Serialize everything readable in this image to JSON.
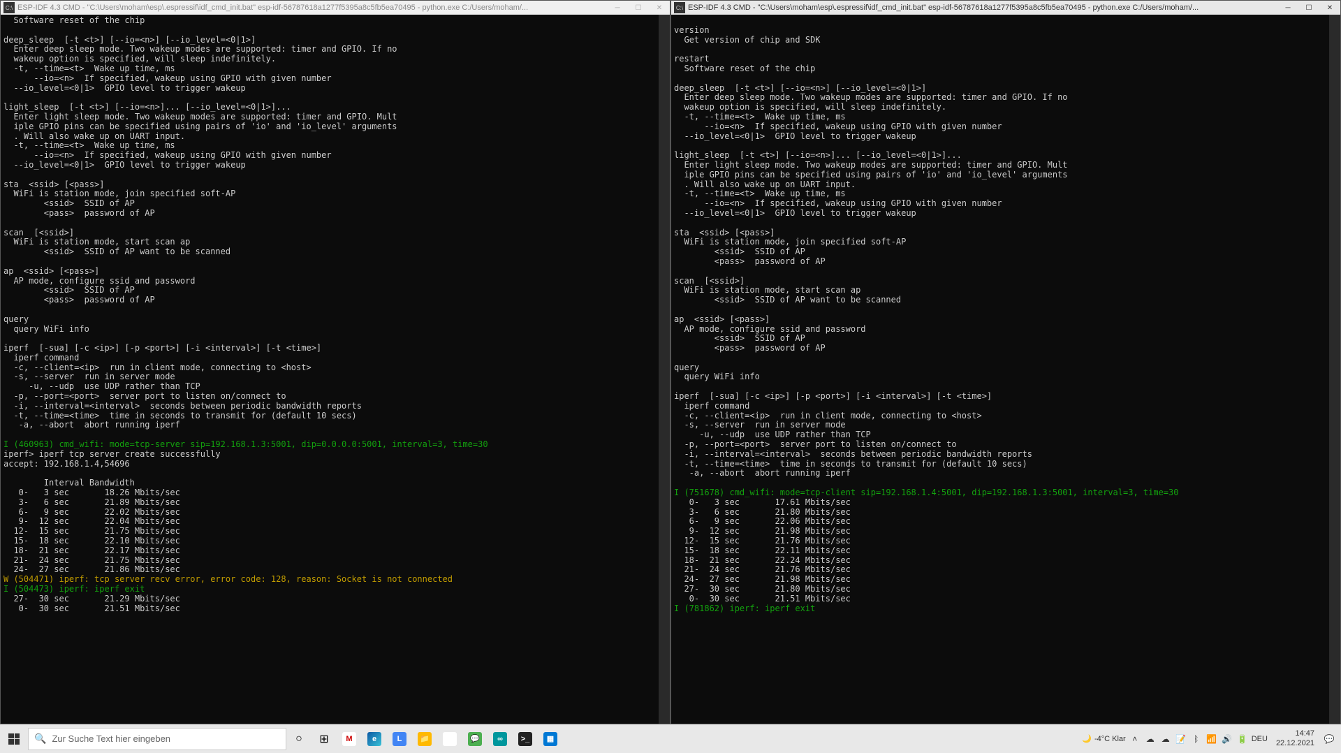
{
  "window_left": {
    "title": "ESP-IDF 4.3 CMD - \"C:\\Users\\moham\\esp\\.espressif\\idf_cmd_init.bat\"  esp-idf-56787618a1277f5395a8c5fb5ea70495 - python.exe  C:/Users/moham/...",
    "lines": [
      {
        "t": "  Software reset of the chip"
      },
      {
        "t": ""
      },
      {
        "t": "deep_sleep  [-t <t>] [--io=<n>] [--io_level=<0|1>]"
      },
      {
        "t": "  Enter deep sleep mode. Two wakeup modes are supported: timer and GPIO. If no"
      },
      {
        "t": "  wakeup option is specified, will sleep indefinitely."
      },
      {
        "t": "  -t, --time=<t>  Wake up time, ms"
      },
      {
        "t": "      --io=<n>  If specified, wakeup using GPIO with given number"
      },
      {
        "t": "  --io_level=<0|1>  GPIO level to trigger wakeup"
      },
      {
        "t": ""
      },
      {
        "t": "light_sleep  [-t <t>] [--io=<n>]... [--io_level=<0|1>]..."
      },
      {
        "t": "  Enter light sleep mode. Two wakeup modes are supported: timer and GPIO. Mult"
      },
      {
        "t": "  iple GPIO pins can be specified using pairs of 'io' and 'io_level' arguments"
      },
      {
        "t": "  . Will also wake up on UART input."
      },
      {
        "t": "  -t, --time=<t>  Wake up time, ms"
      },
      {
        "t": "      --io=<n>  If specified, wakeup using GPIO with given number"
      },
      {
        "t": "  --io_level=<0|1>  GPIO level to trigger wakeup"
      },
      {
        "t": ""
      },
      {
        "t": "sta  <ssid> [<pass>]"
      },
      {
        "t": "  WiFi is station mode, join specified soft-AP"
      },
      {
        "t": "        <ssid>  SSID of AP"
      },
      {
        "t": "        <pass>  password of AP"
      },
      {
        "t": ""
      },
      {
        "t": "scan  [<ssid>]"
      },
      {
        "t": "  WiFi is station mode, start scan ap"
      },
      {
        "t": "        <ssid>  SSID of AP want to be scanned"
      },
      {
        "t": ""
      },
      {
        "t": "ap  <ssid> [<pass>]"
      },
      {
        "t": "  AP mode, configure ssid and password"
      },
      {
        "t": "        <ssid>  SSID of AP"
      },
      {
        "t": "        <pass>  password of AP"
      },
      {
        "t": ""
      },
      {
        "t": "query"
      },
      {
        "t": "  query WiFi info"
      },
      {
        "t": ""
      },
      {
        "t": "iperf  [-sua] [-c <ip>] [-p <port>] [-i <interval>] [-t <time>]"
      },
      {
        "t": "  iperf command"
      },
      {
        "t": "  -c, --client=<ip>  run in client mode, connecting to <host>"
      },
      {
        "t": "  -s, --server  run in server mode"
      },
      {
        "t": "     -u, --udp  use UDP rather than TCP"
      },
      {
        "t": "  -p, --port=<port>  server port to listen on/connect to"
      },
      {
        "t": "  -i, --interval=<interval>  seconds between periodic bandwidth reports"
      },
      {
        "t": "  -t, --time=<time>  time in seconds to transmit for (default 10 secs)"
      },
      {
        "t": "   -a, --abort  abort running iperf"
      },
      {
        "t": ""
      },
      {
        "t": "I (460963) cmd_wifi: mode=tcp-server sip=192.168.1.3:5001, dip=0.0.0.0:5001, interval=3, time=30",
        "c": "g"
      },
      {
        "t": "iperf> iperf tcp server create successfully"
      },
      {
        "t": "accept: 192.168.1.4,54696"
      },
      {
        "t": ""
      },
      {
        "t": "        Interval Bandwidth"
      },
      {
        "t": "   0-   3 sec       18.26 Mbits/sec"
      },
      {
        "t": "   3-   6 sec       21.89 Mbits/sec"
      },
      {
        "t": "   6-   9 sec       22.02 Mbits/sec"
      },
      {
        "t": "   9-  12 sec       22.04 Mbits/sec"
      },
      {
        "t": "  12-  15 sec       21.75 Mbits/sec"
      },
      {
        "t": "  15-  18 sec       22.10 Mbits/sec"
      },
      {
        "t": "  18-  21 sec       22.17 Mbits/sec"
      },
      {
        "t": "  21-  24 sec       21.75 Mbits/sec"
      },
      {
        "t": "  24-  27 sec       21.86 Mbits/sec"
      },
      {
        "t": "W (504471) iperf: tcp server recv error, error code: 128, reason: Socket is not connected",
        "c": "y"
      },
      {
        "t": "I (504473) iperf: iperf exit",
        "c": "g"
      },
      {
        "t": "  27-  30 sec       21.29 Mbits/sec"
      },
      {
        "t": "   0-  30 sec       21.51 Mbits/sec"
      }
    ]
  },
  "window_right": {
    "title": "ESP-IDF 4.3 CMD - \"C:\\Users\\moham\\esp\\.espressif\\idf_cmd_init.bat\"  esp-idf-56787618a1277f5395a8c5fb5ea70495 - python.exe  C:/Users/moham/...",
    "lines": [
      {
        "t": ""
      },
      {
        "t": "version"
      },
      {
        "t": "  Get version of chip and SDK"
      },
      {
        "t": ""
      },
      {
        "t": "restart"
      },
      {
        "t": "  Software reset of the chip"
      },
      {
        "t": ""
      },
      {
        "t": "deep_sleep  [-t <t>] [--io=<n>] [--io_level=<0|1>]"
      },
      {
        "t": "  Enter deep sleep mode. Two wakeup modes are supported: timer and GPIO. If no"
      },
      {
        "t": "  wakeup option is specified, will sleep indefinitely."
      },
      {
        "t": "  -t, --time=<t>  Wake up time, ms"
      },
      {
        "t": "      --io=<n>  If specified, wakeup using GPIO with given number"
      },
      {
        "t": "  --io_level=<0|1>  GPIO level to trigger wakeup"
      },
      {
        "t": ""
      },
      {
        "t": "light_sleep  [-t <t>] [--io=<n>]... [--io_level=<0|1>]..."
      },
      {
        "t": "  Enter light sleep mode. Two wakeup modes are supported: timer and GPIO. Mult"
      },
      {
        "t": "  iple GPIO pins can be specified using pairs of 'io' and 'io_level' arguments"
      },
      {
        "t": "  . Will also wake up on UART input."
      },
      {
        "t": "  -t, --time=<t>  Wake up time, ms"
      },
      {
        "t": "      --io=<n>  If specified, wakeup using GPIO with given number"
      },
      {
        "t": "  --io_level=<0|1>  GPIO level to trigger wakeup"
      },
      {
        "t": ""
      },
      {
        "t": "sta  <ssid> [<pass>]"
      },
      {
        "t": "  WiFi is station mode, join specified soft-AP"
      },
      {
        "t": "        <ssid>  SSID of AP"
      },
      {
        "t": "        <pass>  password of AP"
      },
      {
        "t": ""
      },
      {
        "t": "scan  [<ssid>]"
      },
      {
        "t": "  WiFi is station mode, start scan ap"
      },
      {
        "t": "        <ssid>  SSID of AP want to be scanned"
      },
      {
        "t": ""
      },
      {
        "t": "ap  <ssid> [<pass>]"
      },
      {
        "t": "  AP mode, configure ssid and password"
      },
      {
        "t": "        <ssid>  SSID of AP"
      },
      {
        "t": "        <pass>  password of AP"
      },
      {
        "t": ""
      },
      {
        "t": "query"
      },
      {
        "t": "  query WiFi info"
      },
      {
        "t": ""
      },
      {
        "t": "iperf  [-sua] [-c <ip>] [-p <port>] [-i <interval>] [-t <time>]"
      },
      {
        "t": "  iperf command"
      },
      {
        "t": "  -c, --client=<ip>  run in client mode, connecting to <host>"
      },
      {
        "t": "  -s, --server  run in server mode"
      },
      {
        "t": "     -u, --udp  use UDP rather than TCP"
      },
      {
        "t": "  -p, --port=<port>  server port to listen on/connect to"
      },
      {
        "t": "  -i, --interval=<interval>  seconds between periodic bandwidth reports"
      },
      {
        "t": "  -t, --time=<time>  time in seconds to transmit for (default 10 secs)"
      },
      {
        "t": "   -a, --abort  abort running iperf"
      },
      {
        "t": ""
      },
      {
        "t": "I (751678) cmd_wifi: mode=tcp-client sip=192.168.1.4:5001, dip=192.168.1.3:5001, interval=3, time=30",
        "c": "g"
      },
      {
        "t": "   0-   3 sec       17.61 Mbits/sec"
      },
      {
        "t": "   3-   6 sec       21.80 Mbits/sec"
      },
      {
        "t": "   6-   9 sec       22.06 Mbits/sec"
      },
      {
        "t": "   9-  12 sec       21.98 Mbits/sec"
      },
      {
        "t": "  12-  15 sec       21.76 Mbits/sec"
      },
      {
        "t": "  15-  18 sec       22.11 Mbits/sec"
      },
      {
        "t": "  18-  21 sec       22.24 Mbits/sec"
      },
      {
        "t": "  21-  24 sec       21.76 Mbits/sec"
      },
      {
        "t": "  24-  27 sec       21.98 Mbits/sec"
      },
      {
        "t": "  27-  30 sec       21.80 Mbits/sec"
      },
      {
        "t": "   0-  30 sec       21.51 Mbits/sec"
      },
      {
        "t": "I (781862) iperf: iperf exit",
        "c": "g"
      }
    ]
  },
  "taskbar": {
    "search_placeholder": "Zur Suche Text hier eingeben",
    "weather": "-4°C Klar",
    "lang": "DEU",
    "time": "14:47",
    "date": "22.12.2021"
  }
}
